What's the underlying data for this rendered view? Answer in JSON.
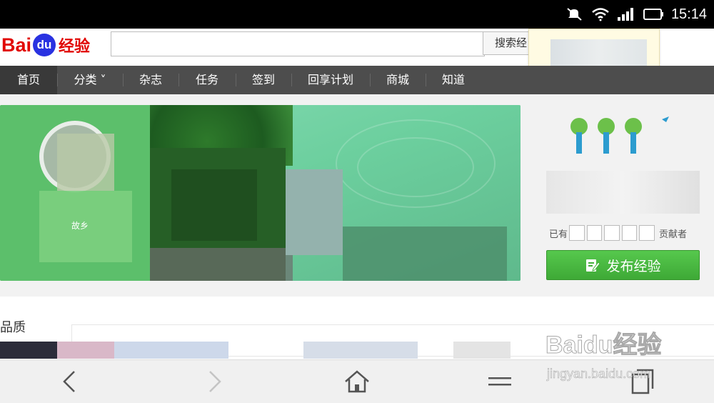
{
  "status_bar": {
    "time": "15:14",
    "icons": [
      "mute-icon",
      "wifi-icon",
      "signal-icon",
      "battery-icon"
    ]
  },
  "header": {
    "logo": {
      "bai": "Bai",
      "du": "du",
      "jy": "经验"
    },
    "search": {
      "value": "",
      "button_label": "搜索经"
    }
  },
  "nav": {
    "items": [
      {
        "label": "首页",
        "active": true
      },
      {
        "label": "分类 ˅"
      },
      {
        "label": "杂志"
      },
      {
        "label": "任务"
      },
      {
        "label": "签到"
      },
      {
        "label": "回享计划"
      },
      {
        "label": "商城"
      },
      {
        "label": "知道"
      }
    ]
  },
  "banner": {
    "caption": "故乡"
  },
  "side": {
    "label_prefix": "已有",
    "label_suffix": "贡献者",
    "publish_label": "发布经验"
  },
  "section": {
    "title": "品质"
  },
  "watermark": {
    "logo": "Baidu经验",
    "url": "jingyan.baidu.com"
  },
  "colors": {
    "nav_bg": "#4d4d4d",
    "publish_green": "#43b03b",
    "logo_red": "#e10602",
    "logo_blue": "#2932e1"
  }
}
